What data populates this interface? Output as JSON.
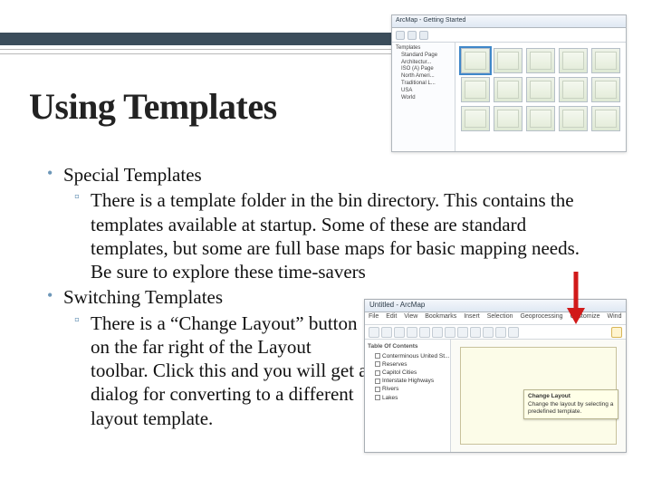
{
  "title": "Using Templates",
  "bullets": [
    {
      "label": "Special Templates",
      "subs": [
        "There is a template folder in the bin directory.  This contains the templates available at startup.  Some of these are standard templates, but some are full base maps for basic mapping needs.  Be sure to explore these time-savers"
      ]
    },
    {
      "label": "Switching Templates",
      "subs": [
        "There is a “Change Layout” button on the far right of the Layout toolbar.  Click this and you will get a dialog for converting to a different layout template."
      ]
    }
  ],
  "gallery": {
    "window_title": "ArcMap - Getting Started",
    "tree": [
      "Templates",
      "Standard Page",
      "Architectur...",
      "ISO (A) Page",
      "North Ameri...",
      "Traditional L...",
      "USA",
      "World"
    ],
    "thumb_count": 15
  },
  "arcmap": {
    "window_title": "Untitled - ArcMap",
    "menu": [
      "File",
      "Edit",
      "View",
      "Bookmarks",
      "Insert",
      "Selection",
      "Geoprocessing",
      "Customize",
      "Wind"
    ],
    "toc_header": "Table Of Contents",
    "frame": "Conterminous United St...",
    "layers": [
      "Reserves",
      "Capitol Cities",
      "Interstate Highways",
      "Rivers",
      "Lakes"
    ],
    "tooltip_title": "Change Layout",
    "tooltip_body": "Change the layout by selecting a predefined template."
  }
}
